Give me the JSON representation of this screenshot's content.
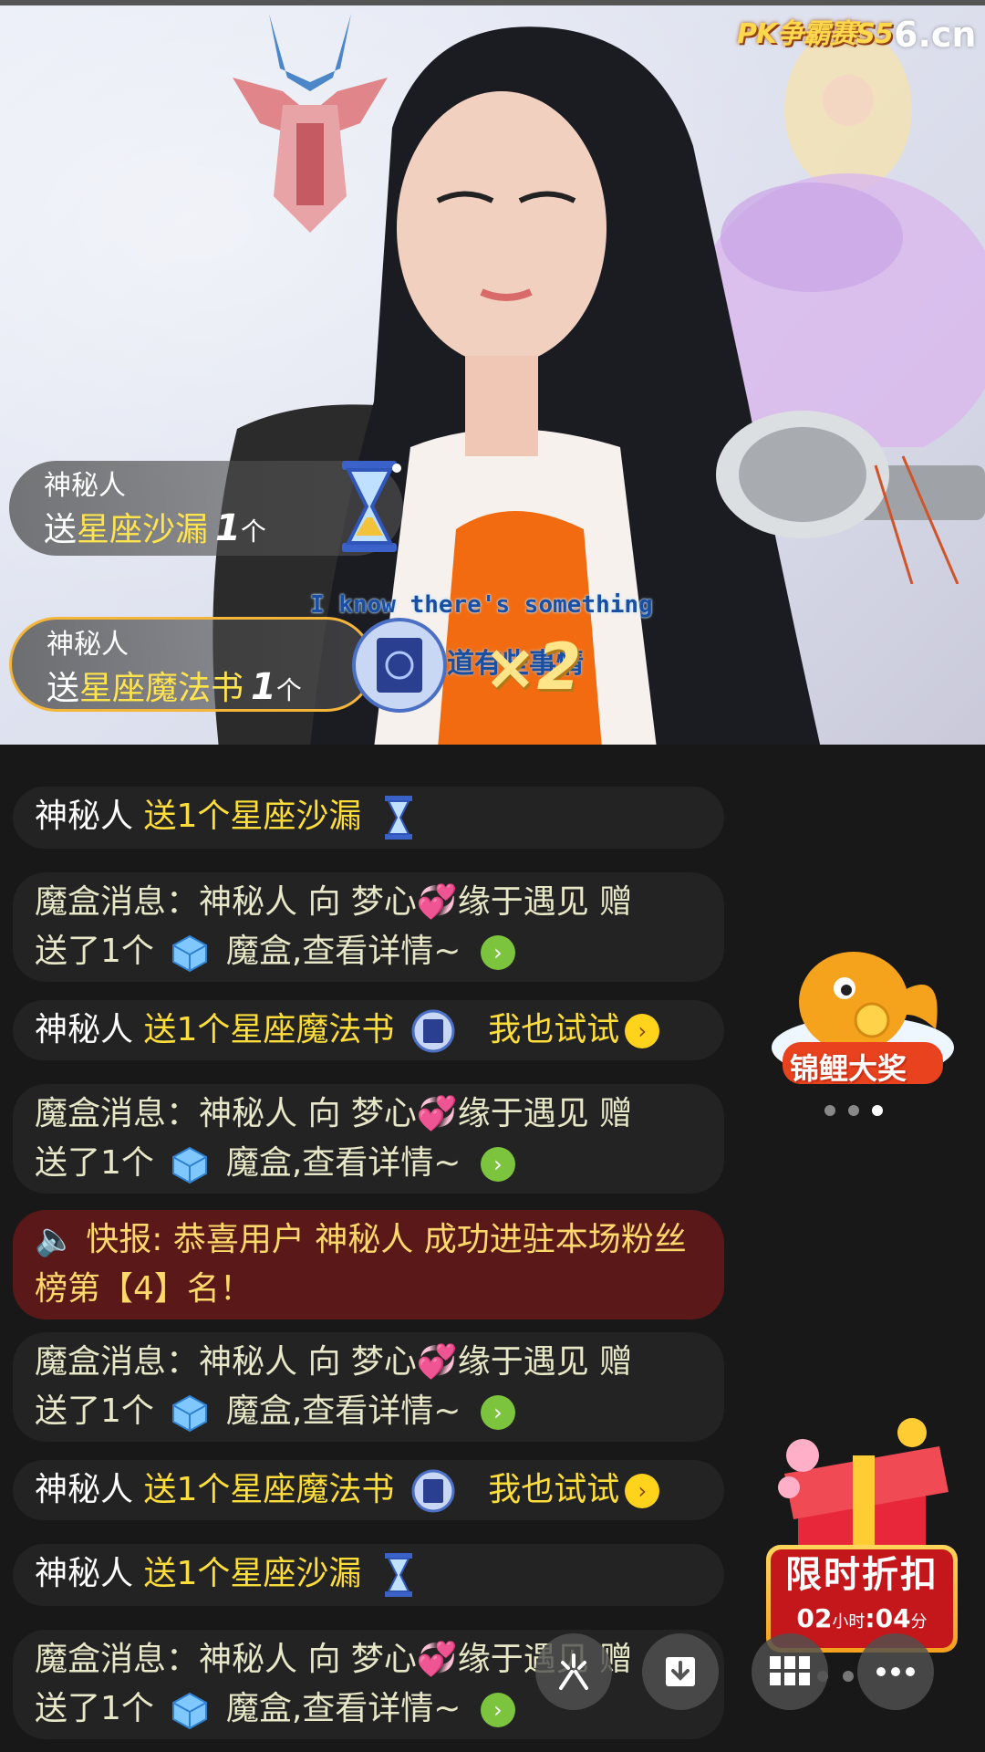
{
  "stream": {
    "event_logo": "PK争霸赛S5",
    "site_logo": "6.cn",
    "subtitle_en": "I know there's something",
    "subtitle_cn": "知道有些事情"
  },
  "gift_popups": [
    {
      "user": "神秘人",
      "send": "送",
      "gift": "星座沙漏",
      "count": "1",
      "unit": "个",
      "icon": "hourglass-icon"
    },
    {
      "user": "神秘人",
      "send": "送",
      "gift": "星座魔法书",
      "count": "1",
      "unit": "个",
      "icon": "magic-book-icon",
      "combo": "×2"
    }
  ],
  "chat": {
    "m1": {
      "user": "神秘人",
      "text": "送1个星座沙漏"
    },
    "box_a": {
      "prefix": "魔盒消息：神秘人 向 梦心",
      "suffix": "缘于遇见 赠",
      "line2a": "送了1个",
      "line2b": "魔盒,查看详情~"
    },
    "m3": {
      "user": "神秘人",
      "text": "送1个星座魔法书",
      "action": "我也试试"
    },
    "notice": {
      "text": "快报: 恭喜用户 神秘人 成功进驻本场粉丝榜第【4】名！"
    },
    "m8": {
      "user": "神秘人",
      "text": "送1个星座沙漏"
    }
  },
  "side": {
    "koi_label": "锦鲤大奖",
    "promo_title": "限时折扣",
    "promo_hours": "02",
    "promo_hours_unit": "小时",
    "promo_minutes": "04",
    "promo_minutes_unit": "分"
  },
  "colors": {
    "highlight": "#ffde3a",
    "chat_bg": "#232323",
    "notice_bg": "#5a1818",
    "go_green": "#7cc33e"
  }
}
